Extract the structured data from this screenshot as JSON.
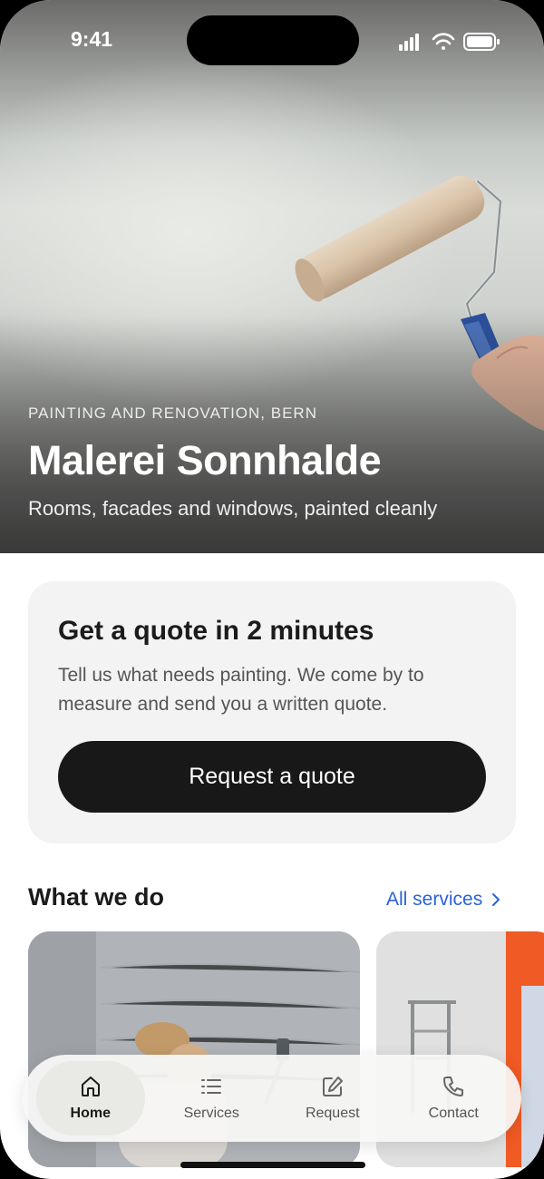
{
  "status": {
    "time": "9:41"
  },
  "hero": {
    "eyebrow": "PAINTING AND RENOVATION, BERN",
    "title": "Malerei Sonnhalde",
    "subtitle": "Rooms, facades and windows, painted cleanly"
  },
  "quote": {
    "title": "Get a quote in 2 minutes",
    "description": "Tell us what needs painting. We come by to measure and send you a written quote.",
    "button_label": "Request a quote"
  },
  "services_section": {
    "title": "What we do",
    "link_label": "All services"
  },
  "tabs": [
    {
      "label": "Home",
      "icon": "home-icon",
      "active": true
    },
    {
      "label": "Services",
      "icon": "list-icon",
      "active": false
    },
    {
      "label": "Request",
      "icon": "edit-icon",
      "active": false
    },
    {
      "label": "Contact",
      "icon": "phone-icon",
      "active": false
    }
  ],
  "colors": {
    "accent": "#2a62d6",
    "button": "#181818",
    "card": "#f3f3f3"
  }
}
